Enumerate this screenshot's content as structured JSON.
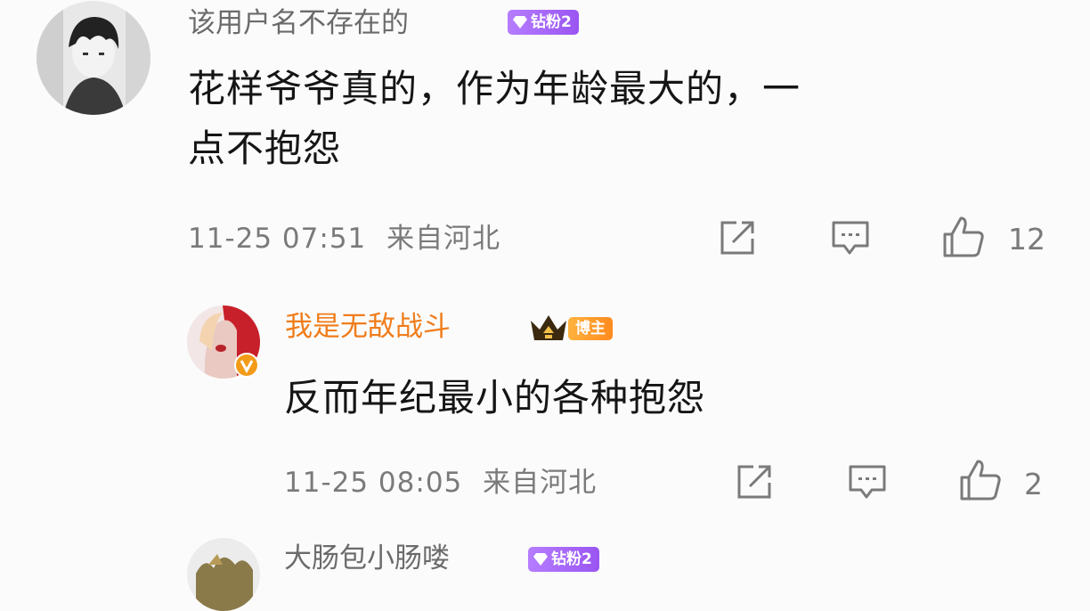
{
  "comments": [
    {
      "username": "该用户名不存在的",
      "badge": "钻粉2",
      "content_line1": "花样爷爷真的，作为年龄最大的，一",
      "content_line2": "点不抱怨",
      "time": "11-25 07:51",
      "location": "来自河北",
      "likes": "12"
    },
    {
      "username": "我是无敌战斗",
      "badge": "博主",
      "content": "反而年纪最小的各种抱怨",
      "time": "11-25 08:05",
      "location": "来自河北",
      "likes": "2"
    },
    {
      "username": "大肠包小肠喽",
      "badge": "钻粉2"
    }
  ],
  "colors": {
    "username_default": "#6b6b6b",
    "username_blogger": "#f07c1a",
    "badge_fan": "#a065f5",
    "badge_blogger": "#ff9a2a",
    "meta": "#7a7a7a"
  },
  "icons": [
    "share-icon",
    "comment-icon",
    "like-icon",
    "gem-icon",
    "crown-icon",
    "verified-v-icon"
  ]
}
